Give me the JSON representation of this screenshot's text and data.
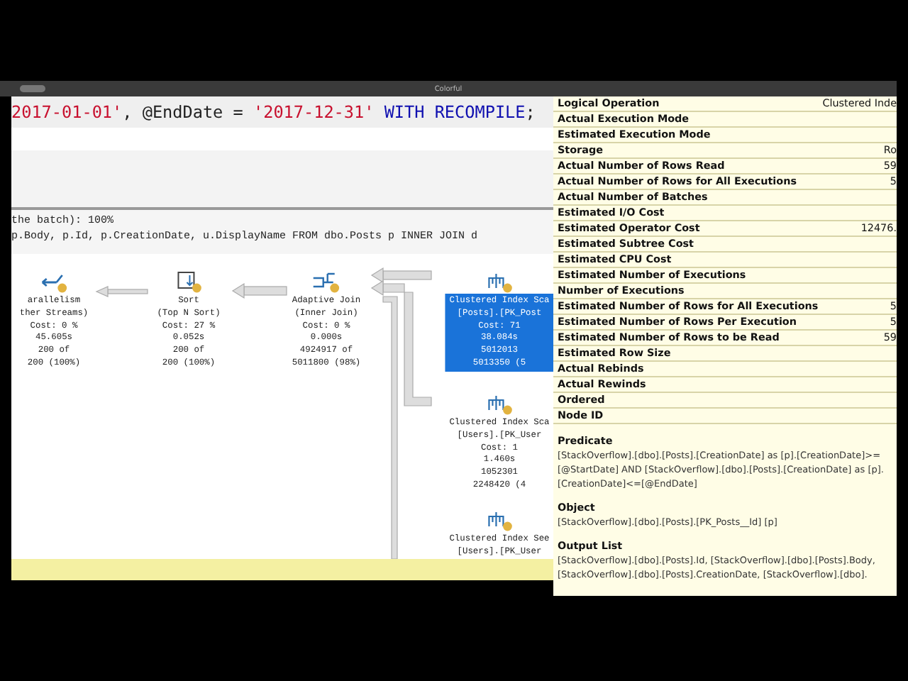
{
  "window": {
    "title": "Colorful"
  },
  "editor": {
    "code_tokens": [
      {
        "kind": "string",
        "text": "2017-01-01'"
      },
      {
        "kind": "plain",
        "text": ", @EndDate = "
      },
      {
        "kind": "string",
        "text": "'2017-12-31'"
      },
      {
        "kind": "keyword",
        "text": " WITH RECOMPILE"
      },
      {
        "kind": "plain",
        "text": ";"
      }
    ]
  },
  "results": {
    "lines": [
      "the batch): 100%",
      "p.Body, p.Id, p.CreationDate, u.DisplayName FROM dbo.Posts p INNER JOIN d"
    ]
  },
  "plan": {
    "nodes": [
      {
        "kind": "parallelism",
        "selected": false,
        "lines": [
          "arallelism",
          "ther Streams)",
          "Cost: 0 %",
          "45.605s",
          "200 of",
          "200 (100%)"
        ]
      },
      {
        "kind": "sort",
        "selected": false,
        "lines": [
          "Sort",
          "(Top N Sort)",
          "Cost: 27 %",
          "0.052s",
          "200 of",
          "200 (100%)"
        ]
      },
      {
        "kind": "join",
        "selected": false,
        "lines": [
          "Adaptive Join",
          "(Inner Join)",
          "Cost: 0 %",
          "0.000s",
          "4924917 of",
          "5011800 (98%)"
        ]
      },
      {
        "kind": "scan",
        "selected": true,
        "lines": [
          "Clustered Index Sca",
          "[Posts].[PK_Post",
          "Cost: 71",
          "38.084s",
          "5012013",
          "5013350 (5"
        ]
      },
      {
        "kind": "scan",
        "selected": false,
        "lines": [
          "Clustered Index Sca",
          "[Users].[PK_User",
          "Cost: 1",
          "1.460s",
          "1052301",
          "2248420 (4"
        ]
      },
      {
        "kind": "seek",
        "selected": false,
        "lines": [
          "Clustered Index See",
          "[Users].[PK_User"
        ]
      }
    ]
  },
  "tooltip": {
    "rows": [
      {
        "name": "Logical Operation",
        "value": "Clustered Inde"
      },
      {
        "name": "Actual Execution Mode"
      },
      {
        "name": "Estimated Execution Mode"
      },
      {
        "name": "Storage",
        "value": "Ro"
      },
      {
        "name": "Actual Number of Rows Read",
        "value": "59"
      },
      {
        "name": "Actual Number of Rows for All Executions",
        "value": "5"
      },
      {
        "name": "Actual Number of Batches"
      },
      {
        "name": "Estimated I/O Cost"
      },
      {
        "name": "Estimated Operator Cost",
        "value": "12476."
      },
      {
        "name": "Estimated Subtree Cost"
      },
      {
        "name": "Estimated CPU Cost"
      },
      {
        "name": "Estimated Number of Executions"
      },
      {
        "name": "Number of Executions"
      },
      {
        "name": "Estimated Number of Rows for All Executions",
        "value": "5"
      },
      {
        "name": "Estimated Number of Rows Per Execution",
        "value": "5"
      },
      {
        "name": "Estimated Number of Rows to be Read",
        "value": "59"
      },
      {
        "name": "Estimated Row Size"
      },
      {
        "name": "Actual Rebinds"
      },
      {
        "name": "Actual Rewinds"
      },
      {
        "name": "Ordered"
      },
      {
        "name": "Node ID"
      }
    ],
    "sections": [
      {
        "heading": "Predicate",
        "text": "[StackOverflow].[dbo].[Posts].[CreationDate] as [p].[CreationDate]>=[@StartDate] AND [StackOverflow].[dbo].[Posts].[CreationDate] as [p].[CreationDate]<=[@EndDate]"
      },
      {
        "heading": "Object",
        "text": "[StackOverflow].[dbo].[Posts].[PK_Posts__Id] [p]"
      },
      {
        "heading": "Output List",
        "text": "[StackOverflow].[dbo].[Posts].Id, [StackOverflow].[dbo].[Posts].Body, [StackOverflow].[dbo].[Posts].CreationDate, [StackOverflow].[dbo]."
      }
    ]
  }
}
